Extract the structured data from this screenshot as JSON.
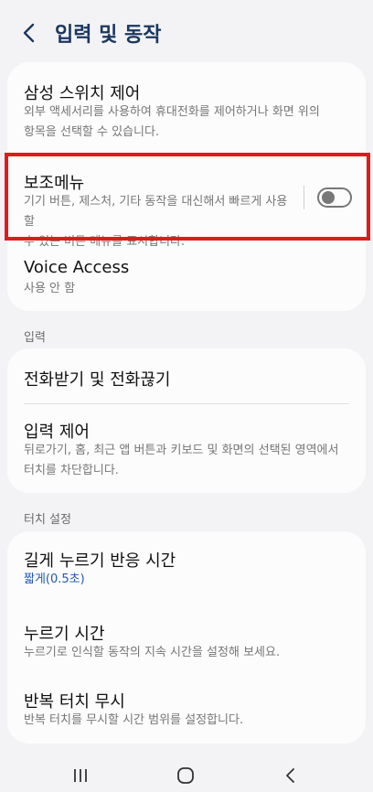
{
  "header": {
    "title": "입력 및 동작"
  },
  "group1": {
    "items": [
      {
        "title": "삼성 스위치 제어",
        "sub": "외부 액세서리를 사용하여 휴대전화를 제어하거나 화면 위의\n항목을 선택할 수 있습니다."
      },
      {
        "title": "보조메뉴",
        "sub": "기기 버튼, 제스처, 기타 동작을 대신해서 빠르게 사용할\n수 있는 버튼 메뉴를 표시합니다.",
        "toggle": false
      },
      {
        "title": "Voice Access",
        "sub": "사용 안 함"
      }
    ]
  },
  "section_input": {
    "label": "입력"
  },
  "group2": {
    "items": [
      {
        "title": "전화받기 및 전화끊기"
      },
      {
        "title": "입력 제어",
        "sub": "뒤로가기, 홈, 최근 앱 버튼과 키보드 및 화면의 선택된 영역에서\n터치를 차단합니다."
      }
    ]
  },
  "section_touch": {
    "label": "터치 설정"
  },
  "group3": {
    "items": [
      {
        "title": "길게 누르기 반응 시간",
        "sub": "짧게(0.5초)"
      },
      {
        "title": "누르기 시간",
        "sub": "누르기로 인식할 동작의 지속 시간을 설정해 보세요."
      },
      {
        "title": "반복 터치 무시",
        "sub": "반복 터치를 무시할 시간 범위를 설정합니다."
      }
    ]
  },
  "colors": {
    "accent": "#2158b6",
    "highlight": "#e01b1b",
    "title": "#1b3760"
  },
  "icons": {
    "back": "chevron-left-icon",
    "recents": "recents-icon",
    "home": "home-icon",
    "nav_back": "nav-back-icon"
  }
}
